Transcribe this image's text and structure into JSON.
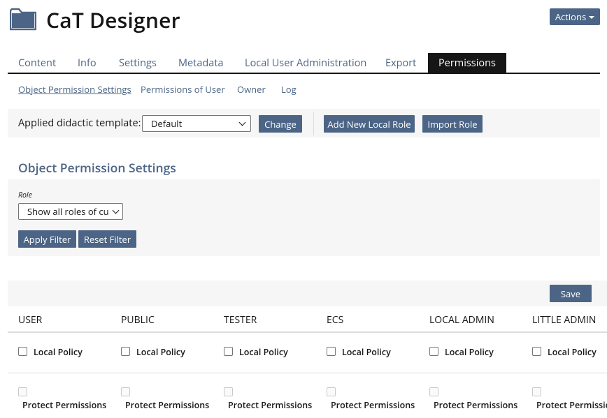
{
  "header": {
    "title": "CaT Designer",
    "actions_label": "Actions"
  },
  "tabs": [
    {
      "label": "Content"
    },
    {
      "label": "Info"
    },
    {
      "label": "Settings"
    },
    {
      "label": "Metadata"
    },
    {
      "label": "Local User Administration"
    },
    {
      "label": "Export"
    },
    {
      "label": "Permissions",
      "active": true
    }
  ],
  "subtabs": [
    {
      "label": "Object Permission Settings",
      "active": true
    },
    {
      "label": "Permissions of User"
    },
    {
      "label": "Owner"
    },
    {
      "label": "Log"
    }
  ],
  "toolbar": {
    "template_label": "Applied didactic template:",
    "template_value": "Default",
    "change_label": "Change",
    "add_role_label": "Add New Local Role",
    "import_role_label": "Import Role"
  },
  "section": {
    "title": "Object Permission Settings",
    "role_label": "Role",
    "role_value": "Show all roles of cur",
    "apply_filter_label": "Apply Filter",
    "reset_filter_label": "Reset Filter"
  },
  "table": {
    "save_label": "Save",
    "columns": [
      "USER",
      "PUBLIC",
      "TESTER",
      "ECS",
      "LOCAL ADMIN",
      "LITTLE ADMIN"
    ],
    "local_policy_label": "Local Policy",
    "protect_label": "Protect Permissions"
  },
  "colors": {
    "accent": "#4c6586",
    "text": "#161616",
    "panel": "#f6f6f6"
  }
}
